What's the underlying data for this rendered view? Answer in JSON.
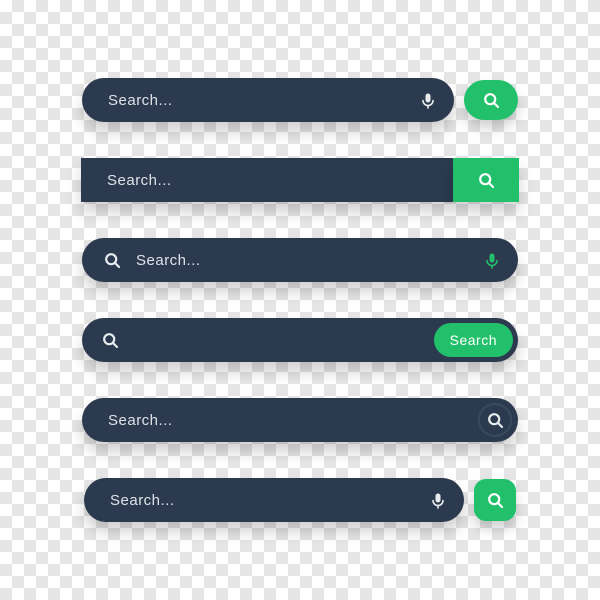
{
  "colors": {
    "bar": "#2b3a4e",
    "accent": "#22c06b",
    "text": "#e8ecef"
  },
  "bars": [
    {
      "placeholder": "Search..."
    },
    {
      "placeholder": "Search..."
    },
    {
      "placeholder": "Search..."
    },
    {
      "placeholder": "",
      "button_label": "Search"
    },
    {
      "placeholder": "Search..."
    },
    {
      "placeholder": "Search..."
    }
  ]
}
